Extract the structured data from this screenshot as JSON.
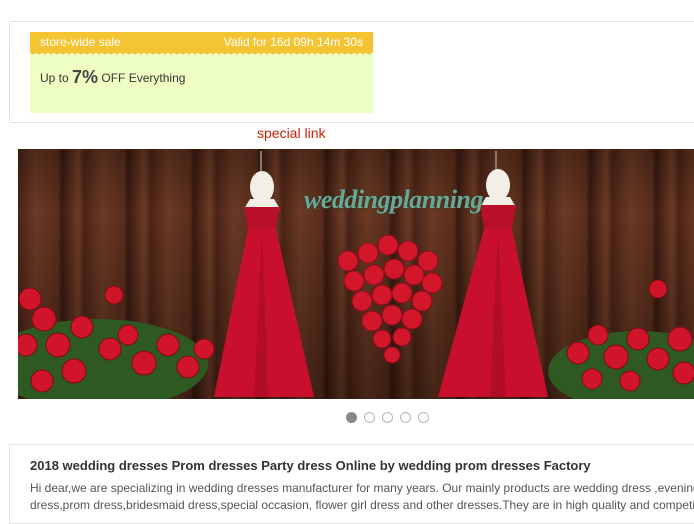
{
  "coupon": {
    "title": "store-wide sale",
    "timer": "Valid for 16d 09h 14m 30s",
    "prefix": "Up to",
    "percent": "7%",
    "suffix": "OFF Everything"
  },
  "special_link": "special link",
  "banner": {
    "brand_text": "weddingplanning",
    "slides_total": 5,
    "active_slide": 1
  },
  "info": {
    "title": "2018 wedding dresses Prom dresses Party dress Online by wedding prom dresses Factory",
    "line1": "Hi dear,we are specializing in wedding dresses manufacturer for many years. Our mainly products are wedding dress ,evening",
    "line2": "dress,prom dress,bridesmaid dress,special occasion, flower girl dress and other dresses.They are in high quality and competitive"
  },
  "colors": {
    "coupon_header": "#f4c433",
    "coupon_body": "#eeffc4",
    "link": "#cc2200",
    "dress": "#c8102e"
  }
}
